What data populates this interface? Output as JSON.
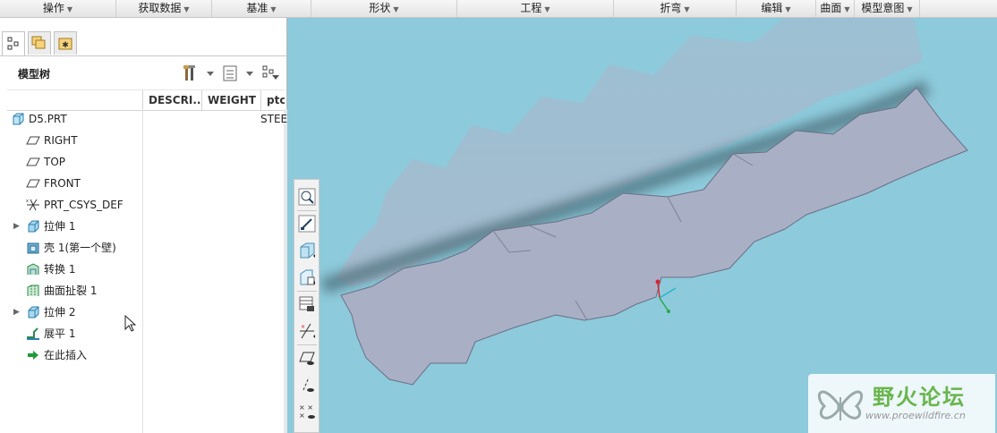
{
  "menubar": {
    "items": [
      {
        "label": "操作"
      },
      {
        "label": "获取数据"
      },
      {
        "label": "基准"
      },
      {
        "label": "形状"
      },
      {
        "label": "工程"
      },
      {
        "label": "折弯"
      },
      {
        "label": "编辑"
      },
      {
        "label": "曲面"
      },
      {
        "label": "模型意图"
      }
    ]
  },
  "left_panel": {
    "tabs": [
      {
        "icon": "model-tree-icon",
        "active": true
      },
      {
        "icon": "layers-icon",
        "active": false
      },
      {
        "icon": "favorites-icon",
        "active": false
      }
    ],
    "title": "模型树",
    "toolbar": {
      "settings_icon": "tools-icon",
      "show_icon": "list-settings-icon",
      "filter_icon": "tree-filter-icon"
    },
    "columns": [
      "DESCRI...",
      "WEIGHT",
      "ptc_"
    ],
    "tree": [
      {
        "label": "D5.PRT",
        "icon": "part-icon",
        "value": "STEE",
        "expandable": false,
        "indent": 0
      },
      {
        "label": "RIGHT",
        "icon": "datum-plane-icon",
        "value": "",
        "expandable": false,
        "indent": 1
      },
      {
        "label": "TOP",
        "icon": "datum-plane-icon",
        "value": "",
        "expandable": false,
        "indent": 1
      },
      {
        "label": "FRONT",
        "icon": "datum-plane-icon",
        "value": "",
        "expandable": false,
        "indent": 1
      },
      {
        "label": "PRT_CSYS_DEF",
        "icon": "csys-icon",
        "value": "",
        "expandable": false,
        "indent": 1
      },
      {
        "label": "拉伸 1",
        "icon": "extrude-icon",
        "value": "",
        "expandable": true,
        "indent": 1
      },
      {
        "label": "壳 1(第一个壁)",
        "icon": "shell-icon",
        "value": "",
        "expandable": false,
        "indent": 1
      },
      {
        "label": "转换 1",
        "icon": "convert-icon",
        "value": "",
        "expandable": false,
        "indent": 1
      },
      {
        "label": "曲面扯裂 1",
        "icon": "rip-icon",
        "value": "",
        "expandable": false,
        "indent": 1
      },
      {
        "label": "拉伸 2",
        "icon": "extrude-icon",
        "value": "",
        "expandable": true,
        "indent": 1
      },
      {
        "label": "展平 1",
        "icon": "flatten-icon",
        "value": "",
        "expandable": false,
        "indent": 1
      },
      {
        "label": "在此插入",
        "icon": "insert-here-arrow-icon",
        "value": "",
        "expandable": false,
        "indent": 1
      }
    ]
  },
  "viewport": {
    "background_color": "#8dcadb",
    "part_color": "#a9b0c6",
    "toolbar_icons": [
      "zoom-icon",
      "repaint-icon",
      "display-style-icon",
      "saved-orientations-icon",
      "view-manager-icon",
      "datum-display-icon",
      "datum-plane-display-icon",
      "datum-axis-display-icon",
      "datum-point-display-icon"
    ]
  },
  "watermark": {
    "title": "野火论坛",
    "url": "www.proewildfire.cn"
  }
}
